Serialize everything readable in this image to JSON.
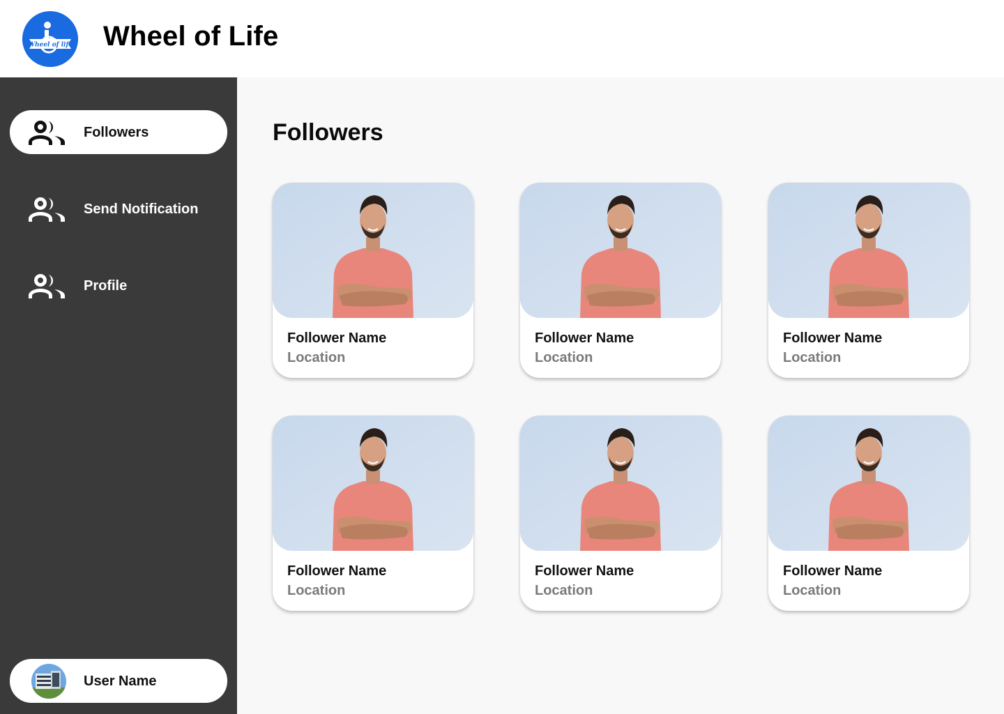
{
  "app": {
    "title": "Wheel of Life",
    "logo_text": "Wheel of life",
    "brand_color": "#1a6ae0"
  },
  "sidebar": {
    "background": "#3a3a3a",
    "items": [
      {
        "label": "Followers",
        "icon": "people-icon",
        "active": true
      },
      {
        "label": "Send Notification",
        "icon": "people-icon",
        "active": false
      },
      {
        "label": "Profile",
        "icon": "people-icon",
        "active": false
      }
    ],
    "user": {
      "name": "User Name",
      "avatar": "building-avatar"
    }
  },
  "main": {
    "title": "Followers",
    "followers": [
      {
        "name": "Follower Name",
        "location": "Location"
      },
      {
        "name": "Follower Name",
        "location": "Location"
      },
      {
        "name": "Follower Name",
        "location": "Location"
      },
      {
        "name": "Follower Name",
        "location": "Location"
      },
      {
        "name": "Follower Name",
        "location": "Location"
      },
      {
        "name": "Follower Name",
        "location": "Location"
      }
    ]
  }
}
